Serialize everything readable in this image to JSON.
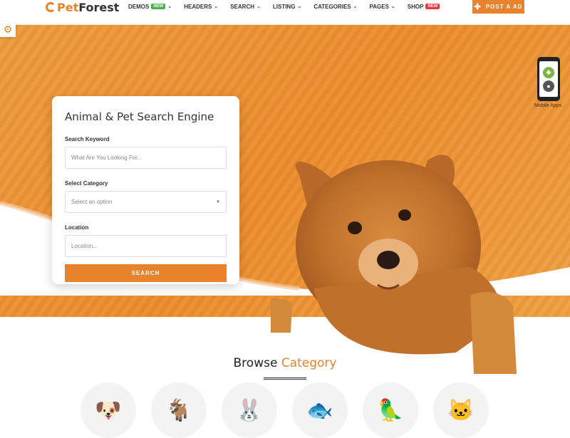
{
  "brand": {
    "prefix": "Pet",
    "suffix": "Forest"
  },
  "nav": [
    {
      "label": "DEMOS",
      "badge": "NEW",
      "badge_color": "#43b34a"
    },
    {
      "label": "HEADERS",
      "badge": null
    },
    {
      "label": "SEARCH",
      "badge": null
    },
    {
      "label": "LISTING",
      "badge": null
    },
    {
      "label": "CATEGORIES",
      "badge": null
    },
    {
      "label": "PAGES",
      "badge": null
    },
    {
      "label": "SHOP",
      "badge": "NEW",
      "badge_color": "#e03b3b"
    }
  ],
  "post_ad": {
    "label": "POST A AD",
    "icon": "plus-icon"
  },
  "settings": {
    "icon": "gear-icon"
  },
  "mobile_apps": {
    "label": "Mobile Apps",
    "icons": [
      "android-icon",
      "apple-icon"
    ]
  },
  "search_card": {
    "title": "Animal & Pet Search Engine",
    "keyword_label": "Search Keyword",
    "keyword_placeholder": "What Are You Looking For...",
    "category_label": "Select Category",
    "category_value": "Select an option",
    "location_label": "Location",
    "location_placeholder": "Location...",
    "button": "SEARCH"
  },
  "browse": {
    "title": "Browse",
    "accent": "Category"
  },
  "categories": [
    {
      "icon": "dog-icon",
      "glyph": "🐶"
    },
    {
      "icon": "goat-icon",
      "glyph": "🐐"
    },
    {
      "icon": "rabbit-icon",
      "glyph": "🐰"
    },
    {
      "icon": "fish-icon",
      "glyph": "🐟"
    },
    {
      "icon": "parrot-icon",
      "glyph": "🦜"
    },
    {
      "icon": "cat-icon",
      "glyph": "🐱"
    }
  ],
  "colors": {
    "accent": "#e8822c",
    "hero": "#ec8c2c",
    "new_green": "#43b34a",
    "new_red": "#e03b3b"
  }
}
